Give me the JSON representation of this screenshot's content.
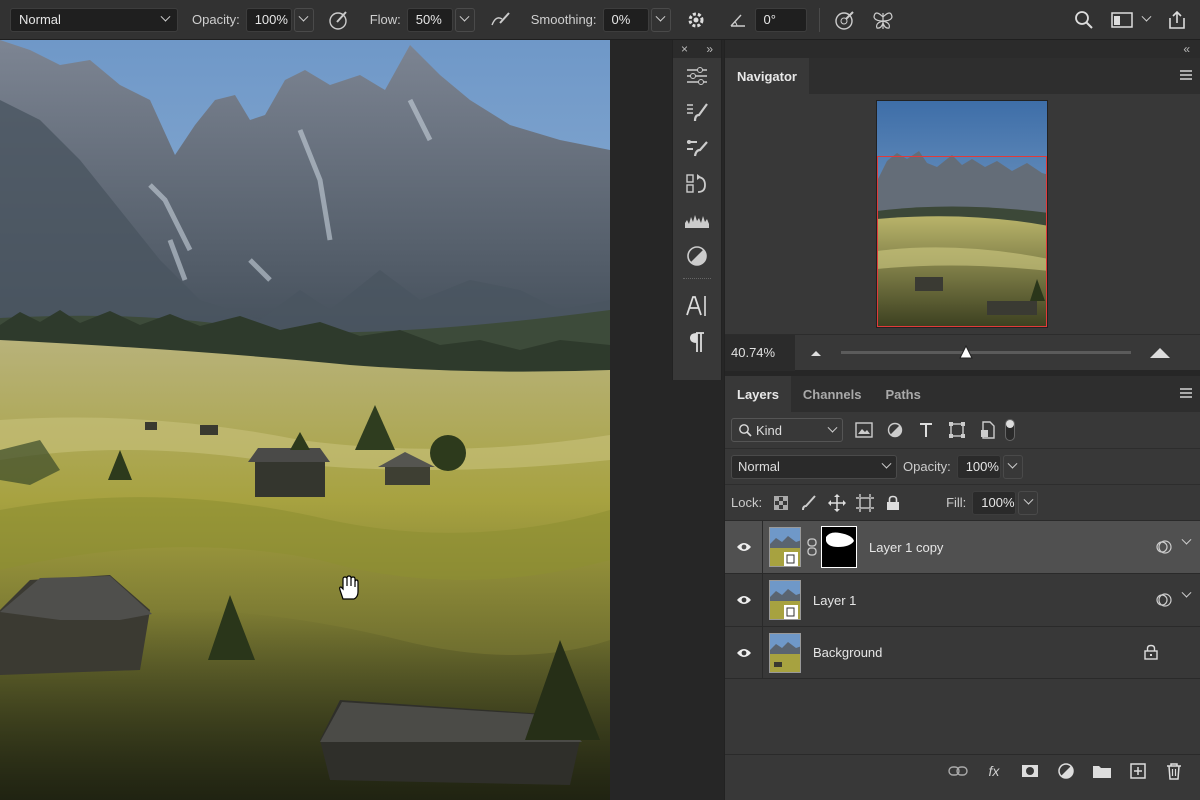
{
  "options_bar": {
    "blend_mode": "Normal",
    "opacity_label": "Opacity:",
    "opacity_value": "100%",
    "flow_label": "Flow:",
    "flow_value": "50%",
    "smoothing_label": "Smoothing:",
    "smoothing_value": "0%",
    "angle_value": "0°"
  },
  "tool_strip": {
    "close": "×",
    "expand": "»"
  },
  "navigator": {
    "collapse": "«",
    "title": "Navigator",
    "zoom": "40.74%"
  },
  "layers_panel": {
    "tabs": [
      {
        "label": "Layers"
      },
      {
        "label": "Channels"
      },
      {
        "label": "Paths"
      }
    ],
    "filter": "Kind",
    "blend_mode": "Normal",
    "opacity_label": "Opacity:",
    "opacity_value": "100%",
    "lock_label": "Lock:",
    "fill_label": "Fill:",
    "fill_value": "100%",
    "layers": [
      {
        "name": "Layer 1 copy"
      },
      {
        "name": "Layer 1"
      },
      {
        "name": "Background"
      }
    ],
    "fx_label": "fx"
  },
  "colors": {
    "selection_red": "#e23a3a",
    "panel_bg": "#383838",
    "selected_layer": "#505050"
  }
}
